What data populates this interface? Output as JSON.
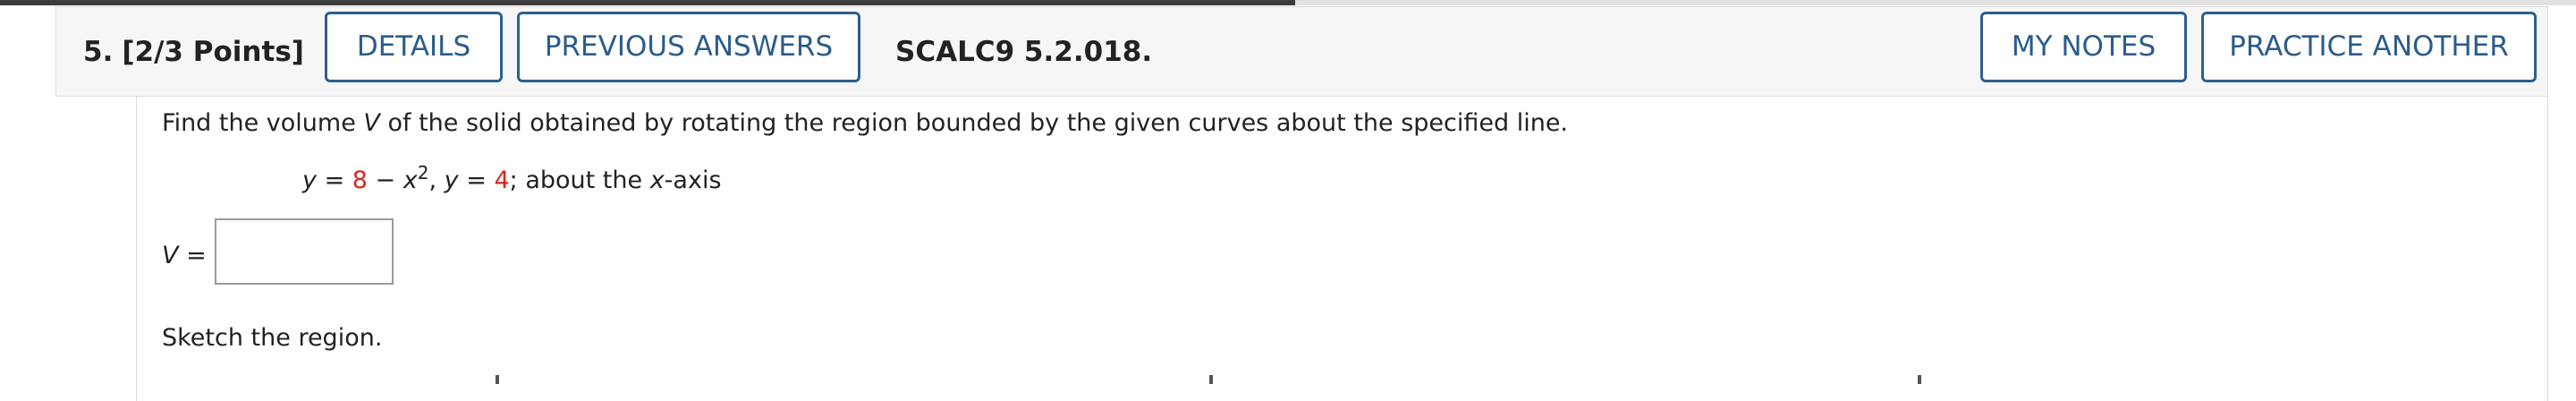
{
  "question": {
    "number": "5.",
    "points": "[2/3 Points]",
    "reference": "SCALC9 5.2.018."
  },
  "buttons": {
    "details": "DETAILS",
    "previous_answers": "PREVIOUS ANSWERS",
    "my_notes": "MY NOTES",
    "practice_another": "PRACTICE ANOTHER"
  },
  "body": {
    "prompt_part1": "Find the volume ",
    "prompt_var": "V",
    "prompt_part2": " of the solid obtained by rotating the region bounded by the given curves about the specified line.",
    "eq": {
      "y1_var": "y",
      "y1_op": " = ",
      "y1_const": "8",
      "y1_minus": " − ",
      "y1_x": "x",
      "y1_exp": "2",
      "sep": ",   ",
      "y2_var": "y",
      "y2_op": " = ",
      "y2_const": "4",
      "semicolon": ";   ",
      "about_prefix": "about the ",
      "about_axis": "x",
      "about_suffix": "-axis"
    },
    "answer_var": "V",
    "answer_eq": " =",
    "answer_value": "",
    "sketch_label": "Sketch the region."
  },
  "colors": {
    "accent": "#2d5f8f",
    "highlight_number": "#d8261c",
    "header_bg": "#f6f6f6"
  }
}
